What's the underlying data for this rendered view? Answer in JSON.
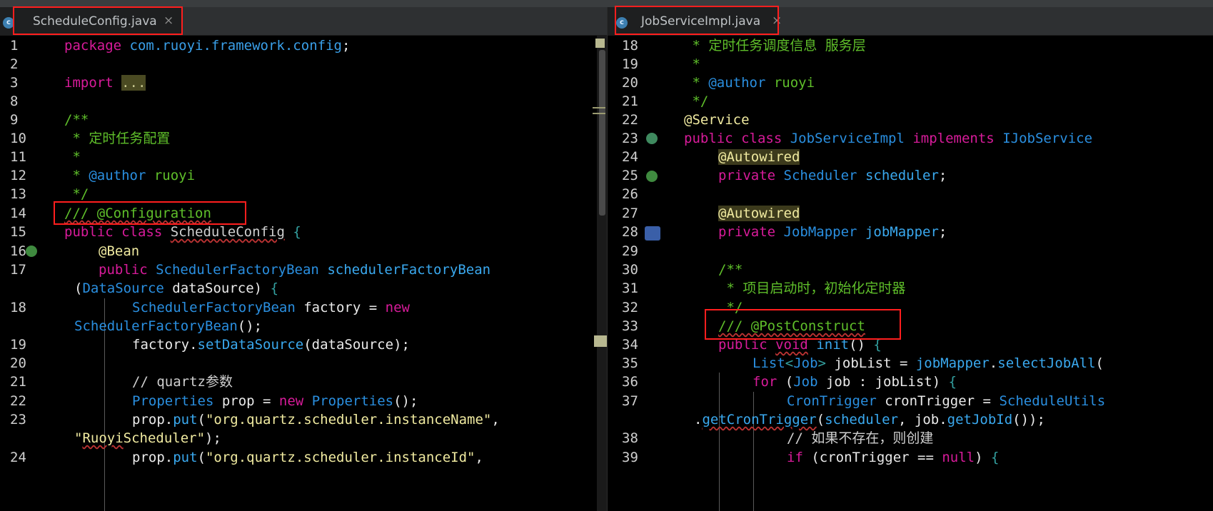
{
  "tabs": {
    "left": {
      "label": "ScheduleConfig.java",
      "icon": "c",
      "close": "×"
    },
    "right": {
      "label": "JobServiceImpl.java",
      "icon": "c",
      "close": "×"
    }
  },
  "left_gutter": [
    "1",
    "2",
    "3",
    "8",
    "9",
    "10",
    "11",
    "12",
    "13",
    "14",
    "15",
    "16",
    "17",
    "",
    "18",
    "",
    "19",
    "20",
    "21",
    "22",
    "23",
    "",
    "24"
  ],
  "right_gutter": [
    "18",
    "19",
    "20",
    "21",
    "22",
    "23",
    "24",
    "25",
    "26",
    "27",
    "28",
    "29",
    "30",
    "31",
    "32",
    "33",
    "34",
    "35",
    "36",
    "37",
    "",
    "38",
    "39"
  ],
  "left_code": {
    "l1a": "package",
    "l1b": "com.ruoyi.framework.config",
    "l1c": ";",
    "l3a": "import",
    "l3b": "...",
    "l9": "/**",
    "l10": " * 定时任务配置",
    "l11": " *",
    "l12a": " * ",
    "l12b": "@author",
    "l12c": " ruoyi",
    "l13": " */",
    "l14": "/// @Configuration",
    "l15a": "public class",
    "l15b": "ScheduleConfig",
    "l15c": "{",
    "l16": "@Bean",
    "l17a": "public",
    "l17b": "SchedulerFactoryBean",
    "l17c": "schedulerFactoryBean",
    "l17d": "(",
    "l17e": "DataSource",
    "l17f": " dataSource) ",
    "l17g": "{",
    "l18a": "SchedulerFactoryBean",
    "l18b": " factory = ",
    "l18c": "new",
    "l18d": "SchedulerFactoryBean",
    "l18e": "();",
    "l19a": "factory.",
    "l19b": "setDataSource",
    "l19c": "(dataSource);",
    "l21": "// quartz参数",
    "l22a": "Properties",
    "l22b": " prop = ",
    "l22c": "new",
    "l22d": "Properties",
    "l22e": "();",
    "l23a": "prop.",
    "l23b": "put",
    "l23c": "(",
    "l23d": "\"org.quartz.scheduler.instanceName\"",
    "l23e": ",",
    "l23f": "\"",
    "l23g": "Ruoyi",
    "l23h": "Scheduler\"",
    "l23i": ");",
    "l24a": "prop.",
    "l24b": "put",
    "l24c": "(",
    "l24d": "\"org.quartz.scheduler.instanceId\"",
    "l24e": ","
  },
  "right_code": {
    "r18": " * 定时任务调度信息 服务层",
    "r19": " *",
    "r20a": " * ",
    "r20b": "@author",
    "r20c": " ruoyi",
    "r21": " */",
    "r22": "@Service",
    "r23a": "public class",
    "r23b": "JobServiceImpl",
    "r23c": "implements",
    "r23d": "IJobService",
    "r24": "@Autowired",
    "r25a": "private",
    "r25b": "Scheduler",
    "r25c": "scheduler",
    "r25d": ";",
    "r27": "@Autowired",
    "r28a": "private",
    "r28b": "JobMapper",
    "r28c": "jobMapper",
    "r28d": ";",
    "r30": "/**",
    "r31": " * 项目启动时，初始化定时器",
    "r32": " */",
    "r33": "/// @PostConstruct",
    "r34a": "public",
    "r34b": "void",
    "r34c": "init",
    "r34d": "() ",
    "r34e": "{",
    "r35a": "List",
    "r35b": "<",
    "r35c": "Job",
    "r35d": ">",
    "r35e": " jobList = ",
    "r35f": "jobMapper",
    "r35g": ".",
    "r35h": "selectJobAll",
    "r35i": "(",
    "r36a": "for",
    "r36b": " (",
    "r36c": "Job",
    "r36d": " job : jobList) ",
    "r36e": "{",
    "r37a": "CronTrigger",
    "r37b": " cronTrigger = ",
    "r37c": "ScheduleUtils",
    "r37d": ".",
    "r37e": "getCronTrigger",
    "r37f": "(",
    "r37g": "scheduler",
    "r37h": ", job.",
    "r37i": "getJobId",
    "r37j": "());",
    "r38": "// 如果不存在，则创建",
    "r39a": "if",
    "r39b": " (cronTrigger == ",
    "r39c": "null",
    "r39d": ") ",
    "r39e": "{"
  }
}
